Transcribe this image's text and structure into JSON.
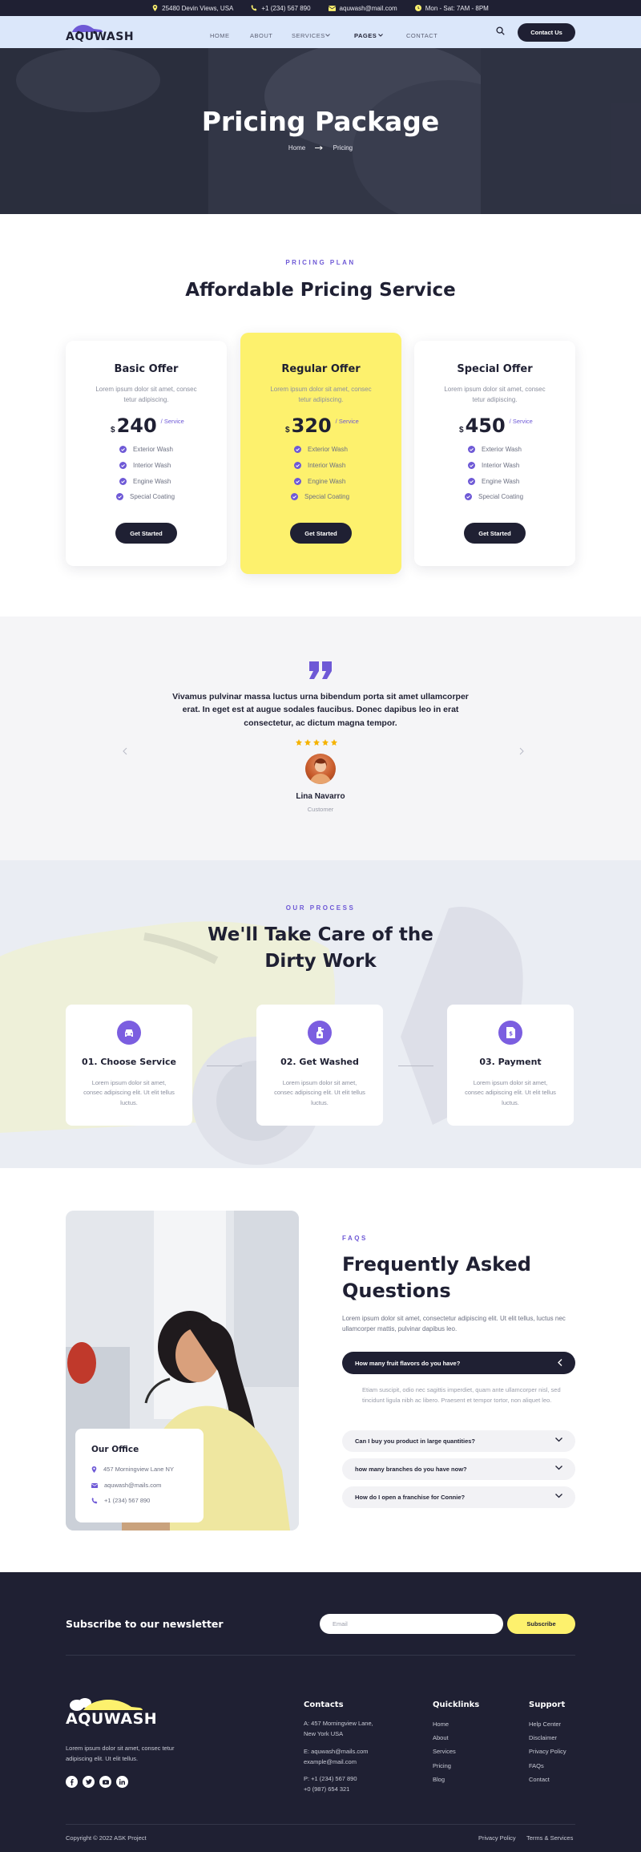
{
  "topbar": {
    "address": "25480 Devin Views, USA",
    "phone": "+1 (234) 567 890",
    "email": "aquwash@mail.com",
    "hours": "Mon - Sat: 7AM - 8PM"
  },
  "header": {
    "logo": "AQUWASH",
    "nav": [
      "HOME",
      "ABOUT",
      "SERVICES",
      "PAGES",
      "CONTACT"
    ],
    "contact_button": "Contact Us"
  },
  "hero": {
    "title": "Pricing Package",
    "breadcrumb_home": "Home",
    "breadcrumb_current": "Pricing"
  },
  "pricing": {
    "eyebrow": "PRICING PLAN",
    "title": "Affordable Pricing Service",
    "plans": [
      {
        "name": "Basic Offer",
        "desc": "Lorem ipsum dolor sit amet, consec tetur adipiscing.",
        "currency": "$",
        "amount": "240",
        "per": "/ Service",
        "features": [
          "Exterior Wash",
          "Interior Wash",
          "Engine Wash",
          "Special Coating"
        ],
        "button": "Get Started"
      },
      {
        "name": "Regular Offer",
        "desc": "Lorem ipsum dolor sit amet, consec tetur adipiscing.",
        "currency": "$",
        "amount": "320",
        "per": "/ Service",
        "features": [
          "Exterior Wash",
          "Interior Wash",
          "Engine Wash",
          "Special Coating"
        ],
        "button": "Get Started"
      },
      {
        "name": "Special Offer",
        "desc": "Lorem ipsum dolor sit amet, consec tetur adipiscing.",
        "currency": "$",
        "amount": "450",
        "per": "/ Service",
        "features": [
          "Exterior Wash",
          "Interior Wash",
          "Engine Wash",
          "Special Coating"
        ],
        "button": "Get Started"
      }
    ]
  },
  "testimonial": {
    "quote_l1": "Vivamus pulvinar massa luctus urna bibendum porta sit amet ullamcorper",
    "quote_l2": "erat. In eget est at augue sodales faucibus. Donec dapibus leo in erat",
    "quote_l3": "consectetur, ac dictum magna tempor.",
    "rating": 5,
    "name": "Lina Navarro",
    "role": "Customer"
  },
  "process": {
    "eyebrow": "OUR PROCESS",
    "title_l1": "We'll Take Care of the",
    "title_l2": "Dirty Work",
    "steps": [
      {
        "title": "01. Choose Service",
        "desc": "Lorem ipsum dolor sit amet, consec adipiscing elit. Ut elit tellus luctus."
      },
      {
        "title": "02. Get Washed",
        "desc": "Lorem ipsum dolor sit amet, consec adipiscing elit. Ut elit tellus luctus."
      },
      {
        "title": "03. Payment",
        "desc": "Lorem ipsum dolor sit amet, consec adipiscing elit. Ut elit tellus luctus."
      }
    ]
  },
  "faq": {
    "eyebrow": "FAQS",
    "title_l1": "Frequently Asked",
    "title_l2": "Questions",
    "desc": "Lorem ipsum dolor sit amet, consectetur adipiscing elit. Ut elit tellus, luctus nec ullamcorper mattis, pulvinar dapibus leo.",
    "open_question": "How many fruit flavors do you have?",
    "open_answer": "Etiam suscipit, odio nec sagittis imperdiet, quam ante ullamcorper nisl, sed tincidunt ligula nibh ac libero. Praesent et tempor tortor, non aliquet leo.",
    "questions": [
      "Can I buy you product in large quantities?",
      "how many branches do you have now?",
      "How do I open a franchise for Connie?"
    ],
    "office": {
      "title": "Our Office",
      "address": "457 Morningview Lane NY",
      "email": "aquwash@mails.com",
      "phone": "+1 (234) 567 890"
    }
  },
  "footer": {
    "newsletter_title": "Subscribe to our newsletter",
    "email_placeholder": "Email",
    "subscribe": "Subscribe",
    "logo": "AQUWASH",
    "about_l1": "Lorem ipsum dolor sit amet, consec tetur",
    "about_l2": "adipiscing elit. Ut elit tellus.",
    "contacts": {
      "heading": "Contacts",
      "addr_l1": "A: 457 Morningview Lane,",
      "addr_l2": "New York USA",
      "email_l1": "E: aquwash@mails.com",
      "email_l2": "example@mail.com",
      "phone_l1": "P: +1 (234) 567 890",
      "phone_l2": "+0 (987) 654 321"
    },
    "quicklinks": {
      "heading": "Quicklinks",
      "items": [
        "Home",
        "About",
        "Services",
        "Pricing",
        "Blog"
      ]
    },
    "support": {
      "heading": "Support",
      "items": [
        "Help Center",
        "Disclaimer",
        "Privacy Policy",
        "FAQs",
        "Contact"
      ]
    },
    "copyright": "Copyright © 2022 ASK Project",
    "bottom_links": [
      "Privacy Policy",
      "Terms & Services"
    ]
  },
  "colors": {
    "dark": "#1f2033",
    "accent": "#6e59d6",
    "yellow": "#fdf16d",
    "star": "#f5b301"
  }
}
